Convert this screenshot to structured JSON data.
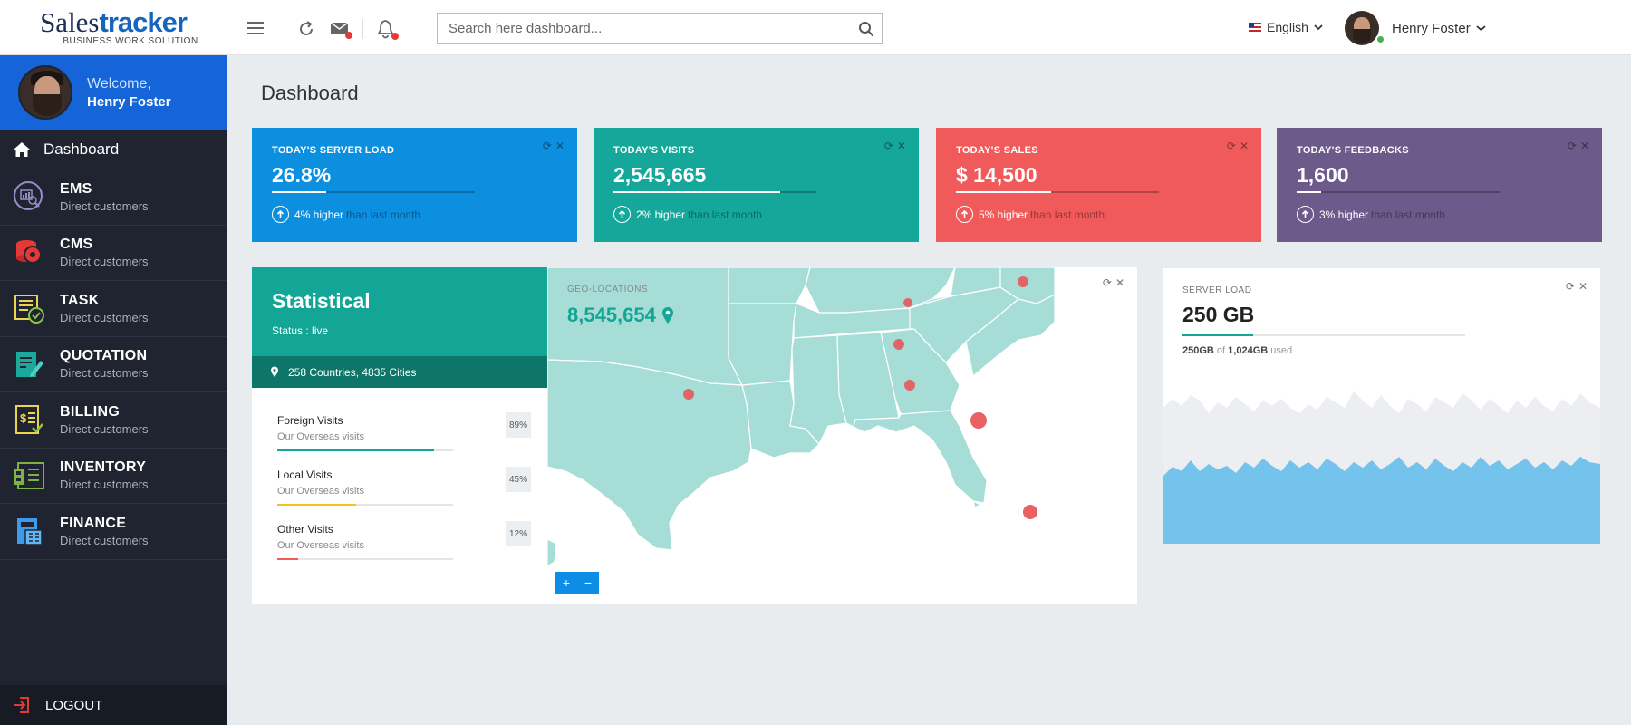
{
  "brand": {
    "name_part1": "Sales",
    "name_part2": "tracker",
    "tagline": "BUSINESS WORK SOLUTION"
  },
  "sidebar": {
    "welcome": "Welcome,",
    "user_name": "Henry Foster",
    "dashboard_label": "Dashboard",
    "items": [
      {
        "label": "EMS",
        "sub": "Direct customers",
        "icon": "ems-icon"
      },
      {
        "label": "CMS",
        "sub": "Direct customers",
        "icon": "cms-icon"
      },
      {
        "label": "TASK",
        "sub": "Direct customers",
        "icon": "task-icon"
      },
      {
        "label": "QUOTATION",
        "sub": "Direct customers",
        "icon": "quotation-icon"
      },
      {
        "label": "BILLING",
        "sub": "Direct customers",
        "icon": "billing-icon"
      },
      {
        "label": "INVENTORY",
        "sub": "Direct customers",
        "icon": "inventory-icon"
      },
      {
        "label": "FINANCE",
        "sub": "Direct customers",
        "icon": "finance-icon"
      }
    ],
    "logout_label": "LOGOUT"
  },
  "topbar": {
    "search_placeholder": "Search here dashboard...",
    "language": "English",
    "user_name": "Henry Foster"
  },
  "page": {
    "title": "Dashboard"
  },
  "stat_cards": [
    {
      "title": "TODAY'S SERVER LOAD",
      "value": "26.8%",
      "change": "4% higher",
      "note": "than last month",
      "color": "#0d8fe0",
      "progress": 0.27
    },
    {
      "title": "TODAY'S VISITS",
      "value": "2,545,665",
      "change": "2% higher",
      "note": "than last month",
      "color": "#14a79a",
      "progress": 0.82
    },
    {
      "title": "TODAY'S SALES",
      "value": "$ 14,500",
      "change": "5% higher",
      "note": "than last month",
      "color": "#f05a5b",
      "progress": 0.47
    },
    {
      "title": "TODAY'S FEEDBACKS",
      "value": "1,600",
      "change": "3% higher",
      "note": "than last month",
      "color": "#6c5a8a",
      "progress": 0.12
    }
  ],
  "statistical": {
    "title": "Statistical",
    "status": "Status : live",
    "locations": "258 Countries, 4835 Cities",
    "visits": [
      {
        "title": "Foreign Visits",
        "sub": "Our Overseas visits",
        "pct": "89%",
        "value": 0.89,
        "color": "#13a596"
      },
      {
        "title": "Local Visits",
        "sub": "Our Overseas visits",
        "pct": "45%",
        "value": 0.45,
        "color": "#f0c419"
      },
      {
        "title": "Other Visits",
        "sub": "Our Overseas visits",
        "pct": "12%",
        "value": 0.12,
        "color": "#f05a5b"
      }
    ]
  },
  "geo": {
    "label": "GEO-LOCATIONS",
    "value": "8,545,654",
    "zoom_in": "+",
    "zoom_out": "−",
    "map_color": "#a6ddd6",
    "marker_color": "#e8585b"
  },
  "server": {
    "label": "SERVER LOAD",
    "value": "250 GB",
    "used": "250GB",
    "of": "of",
    "total": "1,024GB",
    "used_word": "used",
    "progress": 0.25
  },
  "colors": {
    "sidebar_bg": "#1f2430",
    "welcome_bg": "#1565d8",
    "accent_teal": "#13a596",
    "chart_blue": "#74c3ec",
    "chart_grey": "#eceef1"
  }
}
